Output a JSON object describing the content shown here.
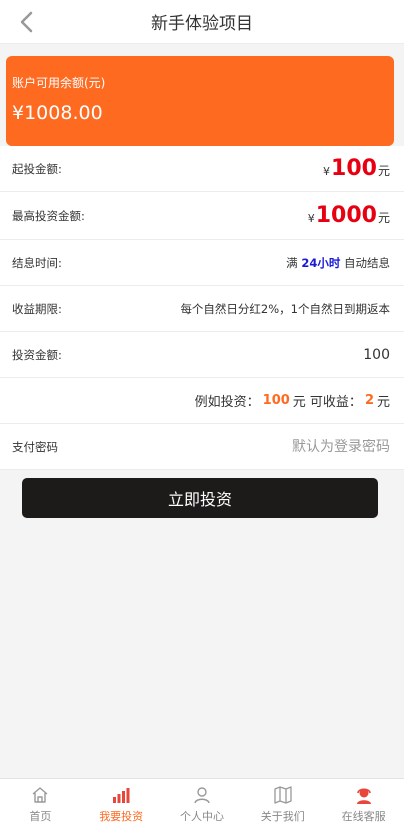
{
  "header": {
    "title": "新手体验项目"
  },
  "balance": {
    "label": "账户可用余额(元)",
    "value": "¥1008.00"
  },
  "rows": {
    "min_invest": {
      "label": "起投金额:",
      "currency": "¥",
      "amount": "100",
      "unit": "元"
    },
    "max_invest": {
      "label": "最高投资金额:",
      "currency": "¥",
      "amount": "1000",
      "unit": "元"
    },
    "settle_time": {
      "label": "结息时间:",
      "prefix": "满",
      "duration": "24小时",
      "suffix": "自动结息"
    },
    "period": {
      "label": "收益期限:",
      "value": "每个自然日分红2%，1个自然日到期返本"
    },
    "amount": {
      "label": "投资金额:",
      "value": "100"
    },
    "example": {
      "text1": "例如投资：",
      "invest": "100",
      "text2": "元 可收益：",
      "profit": "2",
      "text3": "元"
    },
    "password": {
      "label": "支付密码",
      "placeholder": "默认为登录密码"
    }
  },
  "submit_label": "立即投资",
  "tabbar": [
    {
      "label": "首页",
      "icon": "home-icon"
    },
    {
      "label": "我要投资",
      "icon": "bar-chart-icon",
      "active": true
    },
    {
      "label": "个人中心",
      "icon": "user-icon"
    },
    {
      "label": "关于我们",
      "icon": "map-icon"
    },
    {
      "label": "在线客服",
      "icon": "support-agent-icon"
    }
  ],
  "colors": {
    "accent": "#ff6a21",
    "amount_red": "#e60012",
    "duration_blue": "#1a1ad6",
    "button": "#1d1b1a"
  }
}
